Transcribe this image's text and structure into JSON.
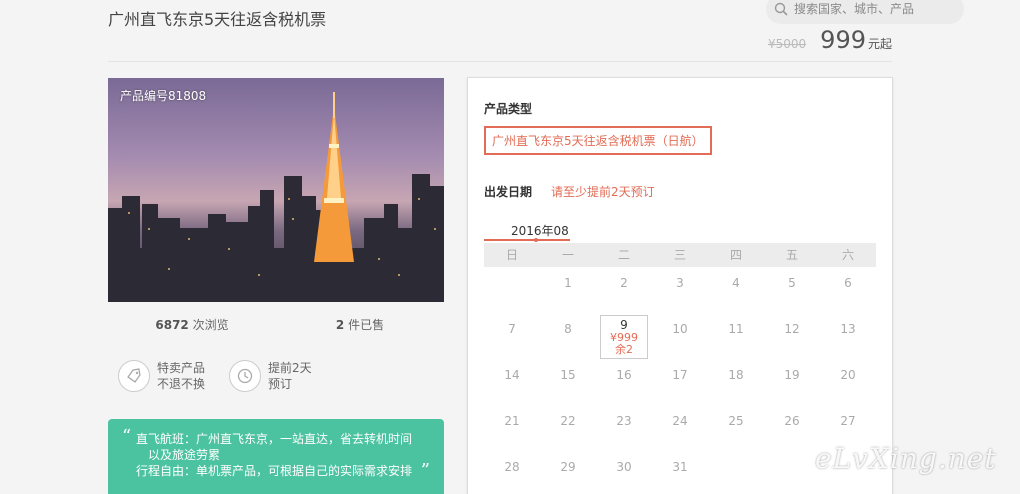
{
  "product": {
    "title": "广州直飞东京5天往返含税机票",
    "code": "产品编号81808",
    "price_old": "¥5000",
    "price_now": "999",
    "price_unit": "元起"
  },
  "search": {
    "placeholder": "搜索国家、城市、产品"
  },
  "stats": {
    "views_count": "6872",
    "views_label": "次浏览",
    "sold_count": "2",
    "sold_label": "件已售"
  },
  "features": [
    {
      "icon": "tag-icon",
      "line1": "特卖产品",
      "line2": "不退不换"
    },
    {
      "icon": "clock-icon",
      "line1": "提前2天",
      "line2": "预订"
    }
  ],
  "highlights": {
    "line1": "直飞航班：广州直飞东京，一站直达，省去转机时间",
    "line2": "以及旅途劳累",
    "line3": "行程自由：单机票产品，可根据自己的实际需求安排"
  },
  "booking": {
    "type_label": "产品类型",
    "type_option": "广州直飞东京5天往返含税机票（日航）",
    "date_label": "出发日期",
    "date_hint": "请至少提前2天预订",
    "month": "2016年08",
    "weekdays": [
      "日",
      "一",
      "二",
      "三",
      "四",
      "五",
      "六"
    ],
    "available": {
      "day": "9",
      "price": "¥999",
      "stock": "余2"
    },
    "accent": "#e26c55"
  },
  "watermark": "eLvXing.net"
}
